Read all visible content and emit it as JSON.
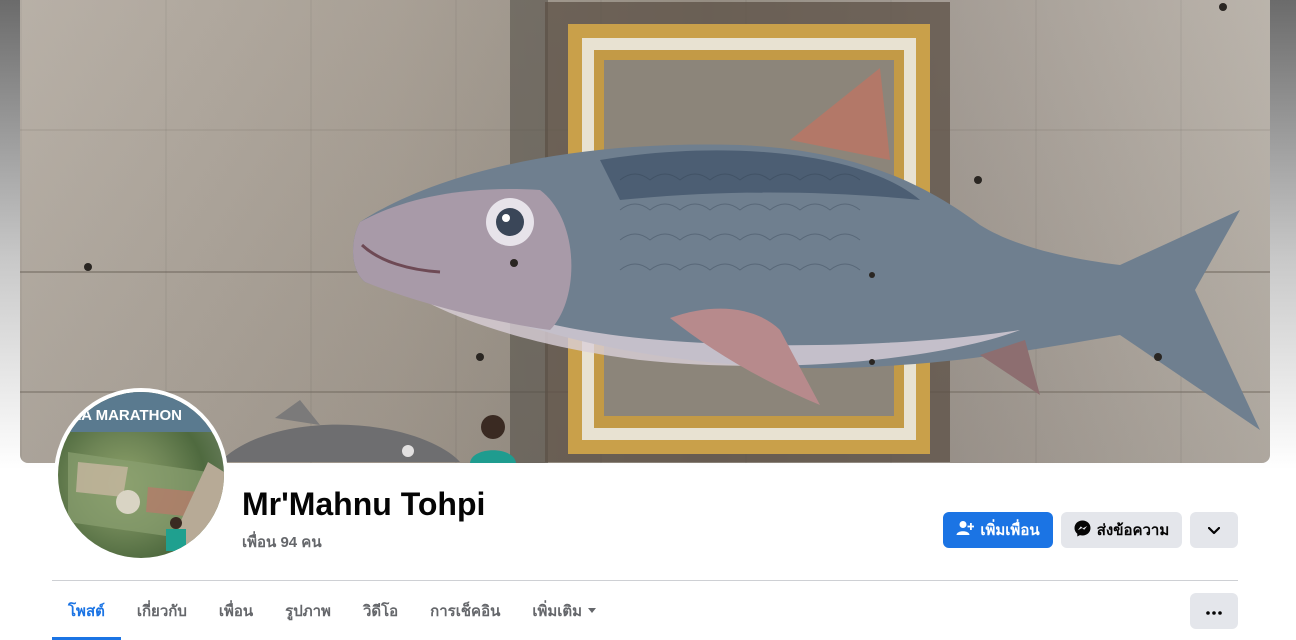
{
  "profile": {
    "name": "Mr'Mahnu Tohpi",
    "friends_text": "เพื่อน 94 คน",
    "avatar_caption": "LA MARATHON"
  },
  "actions": {
    "add_friend_label": "เพิ่มเพื่อน",
    "message_label": "ส่งข้อความ",
    "add_friend_icon": "person-plus-icon",
    "message_icon": "messenger-icon",
    "dropdown_icon": "chevron-down-icon"
  },
  "tabs": [
    {
      "label": "โพสต์",
      "active": true
    },
    {
      "label": "เกี่ยวกับ",
      "active": false
    },
    {
      "label": "เพื่อน",
      "active": false
    },
    {
      "label": "รูปภาพ",
      "active": false
    },
    {
      "label": "วิดีโอ",
      "active": false
    },
    {
      "label": "การเช็คอิน",
      "active": false
    },
    {
      "label": "เพิ่มเติม",
      "active": false
    }
  ],
  "colors": {
    "accent": "#1b74e4",
    "secondary_button": "#e4e6eb",
    "muted_text": "#65676b"
  }
}
